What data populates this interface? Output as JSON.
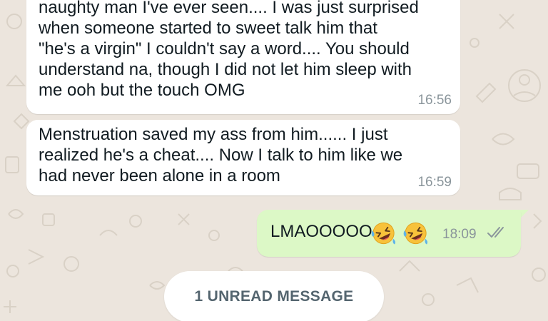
{
  "chat": {
    "messages": [
      {
        "direction": "incoming",
        "text": "naughty man I've ever seen.... I was just surprised\nwhen someone started to sweet talk him that\n\"he's a virgin\" I couldn't say a word.... You should\nunderstand na, though I did not let him sleep with\nme ooh but the touch OMG",
        "time": "16:56"
      },
      {
        "direction": "incoming",
        "text": "Menstruation saved my ass from him...... I just\nrealized he's a cheat.... Now I talk to him like we\nhad never been alone in a room",
        "time": "16:59"
      },
      {
        "direction": "outgoing",
        "text": "LMAOOOOO",
        "emojis": [
          "rolling-on-floor-laughing",
          "rolling-on-floor-laughing"
        ],
        "time": "18:09",
        "status": "read-double-check"
      }
    ],
    "unread_banner": "1 UNREAD MESSAGE"
  },
  "colors": {
    "wallpaper": "#ece5dd",
    "incoming_bubble": "#ffffff",
    "outgoing_bubble": "#dcf8c6",
    "timestamp": "#8a959b",
    "tick": "#8a959b",
    "banner_text": "#54656f"
  }
}
